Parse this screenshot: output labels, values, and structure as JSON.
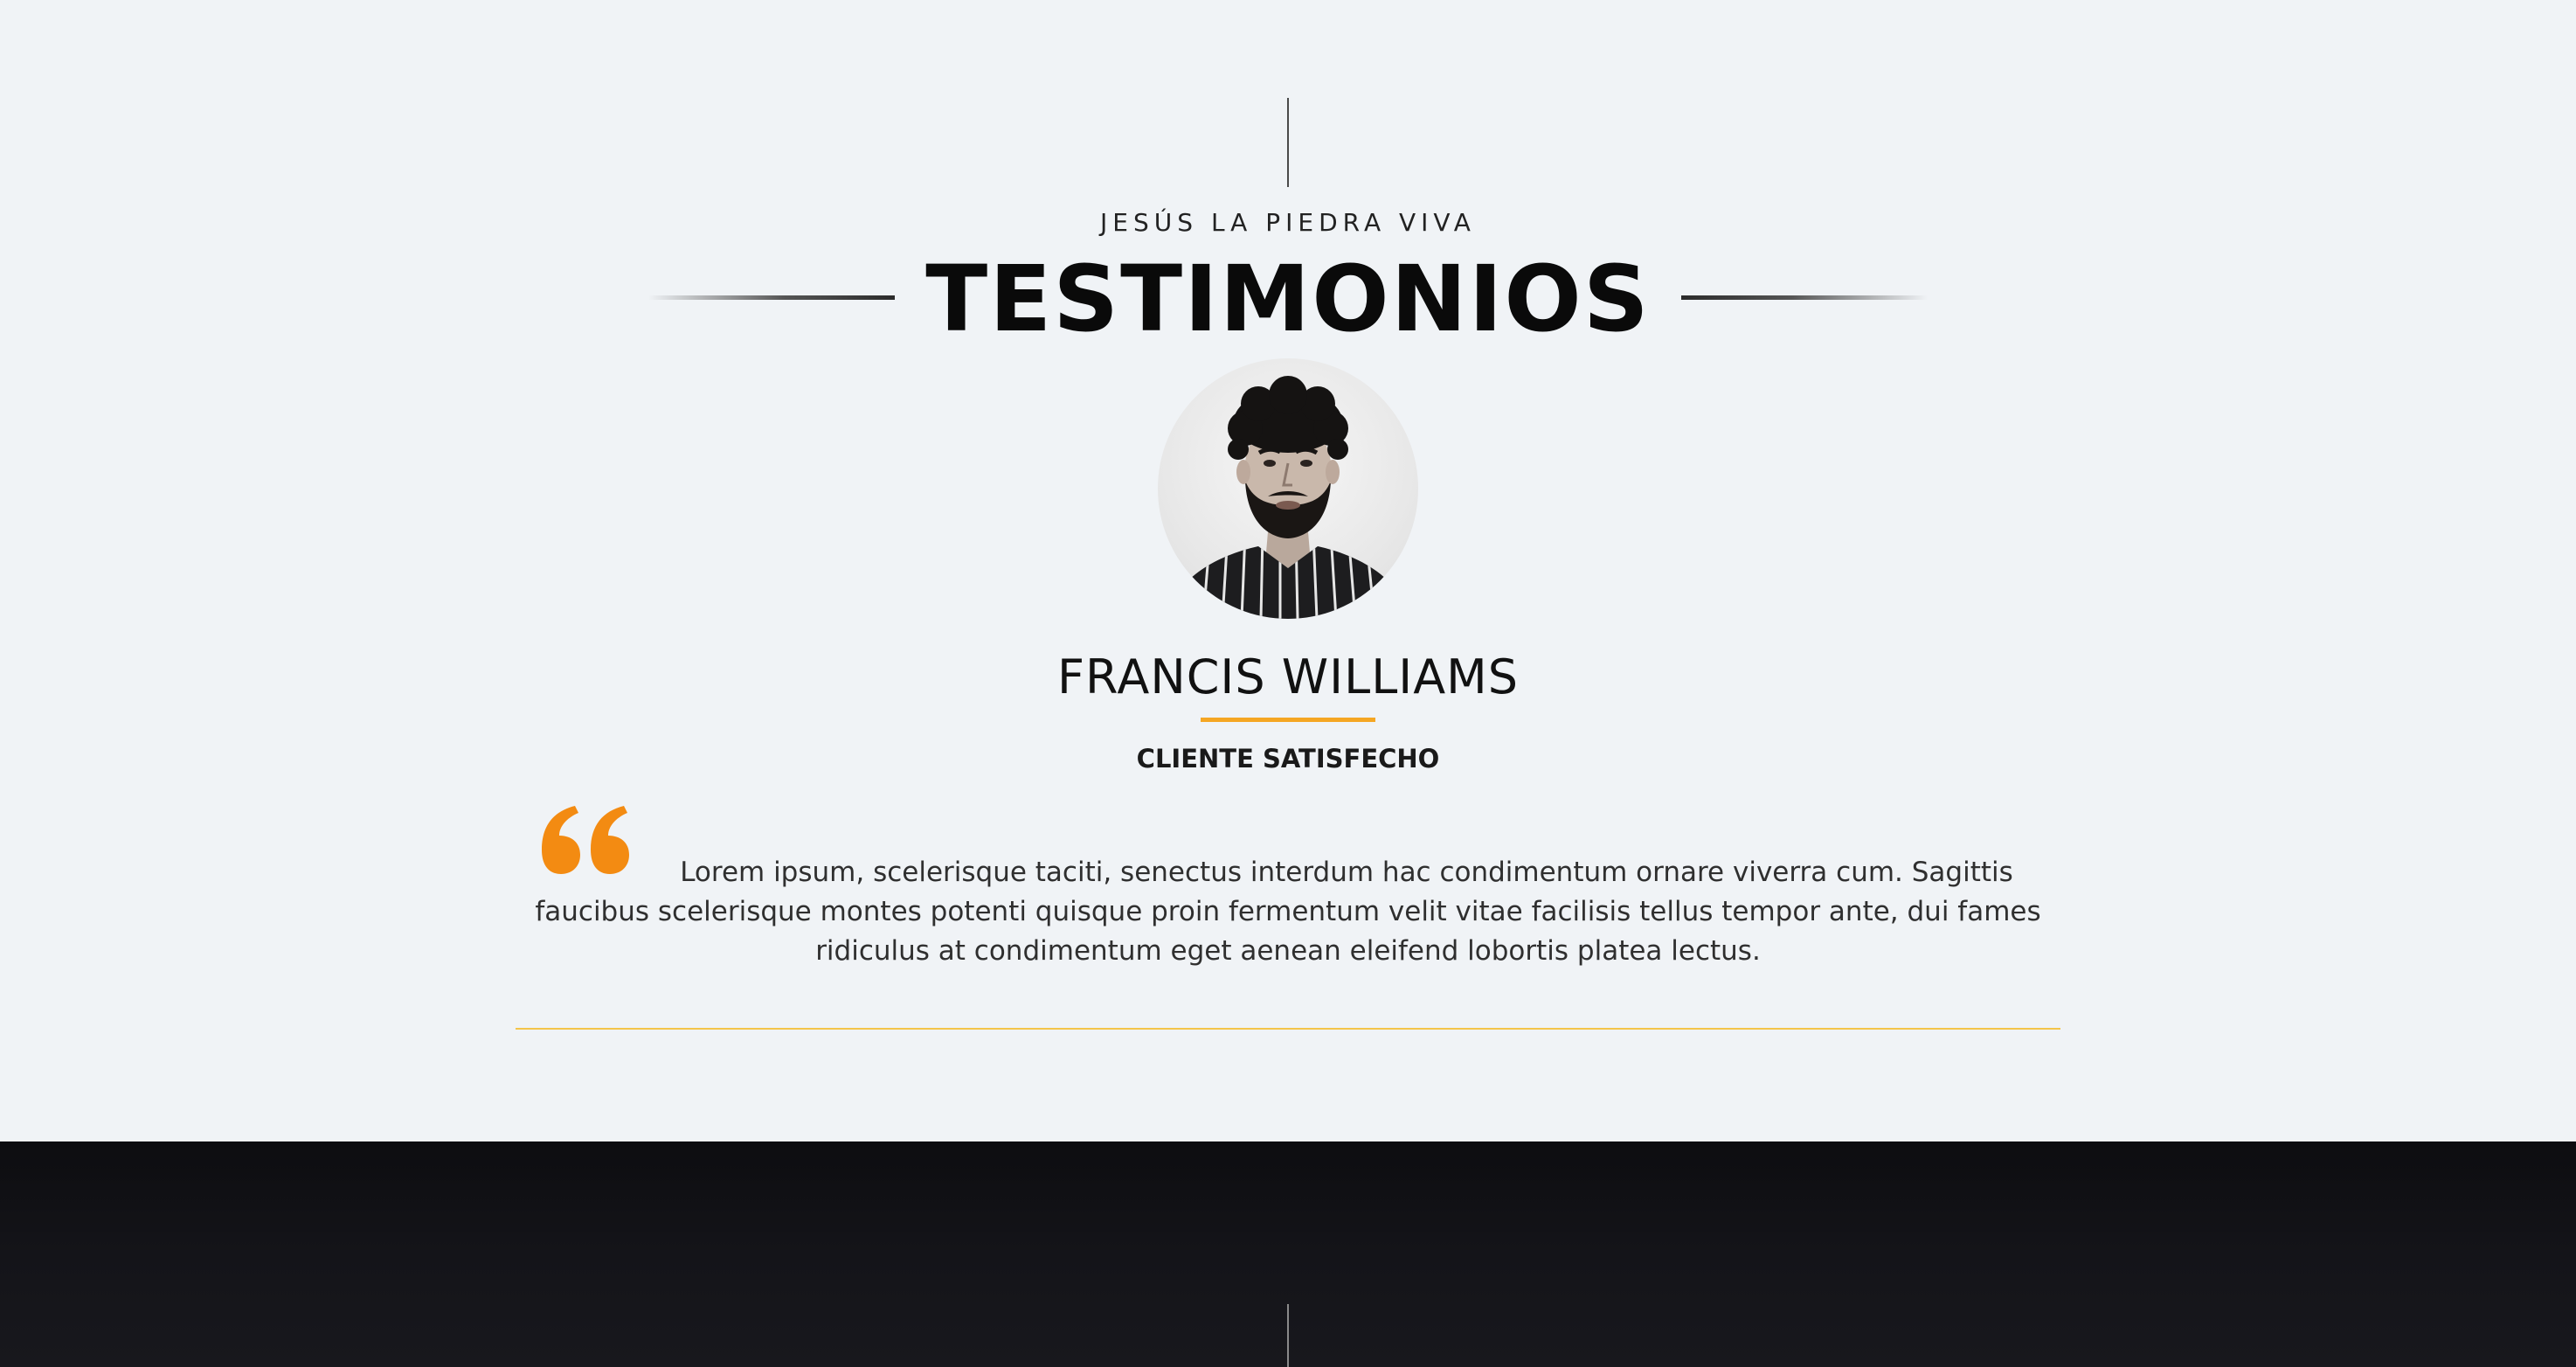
{
  "section": {
    "eyebrow": "JESÚS LA PIEDRA VIVA",
    "title": "TESTIMONIOS"
  },
  "testimonial": {
    "name": "FRANCIS WILLIAMS",
    "role": "CLIENTE SATISFECHO",
    "quote": "Lorem ipsum, scelerisque taciti, senectus interdum hac condimentum ornare viverra cum. Sagittis faucibus scelerisque montes potenti quisque proin fermentum velit vitae facilisis tellus tempor ante, dui fames ridiculus at condimentum eget aenean eleifend lobortis platea lectus.",
    "avatar_icon": "person-portrait-icon",
    "quote_icon": "quote-open-icon"
  },
  "colors": {
    "background": "#f0f3f6",
    "accent_orange": "#f38b12",
    "accent_yellow": "#f5a623",
    "divider_yellow": "#f4c44a",
    "dark_section": "#111115",
    "text_dark": "#0a0a0a"
  }
}
